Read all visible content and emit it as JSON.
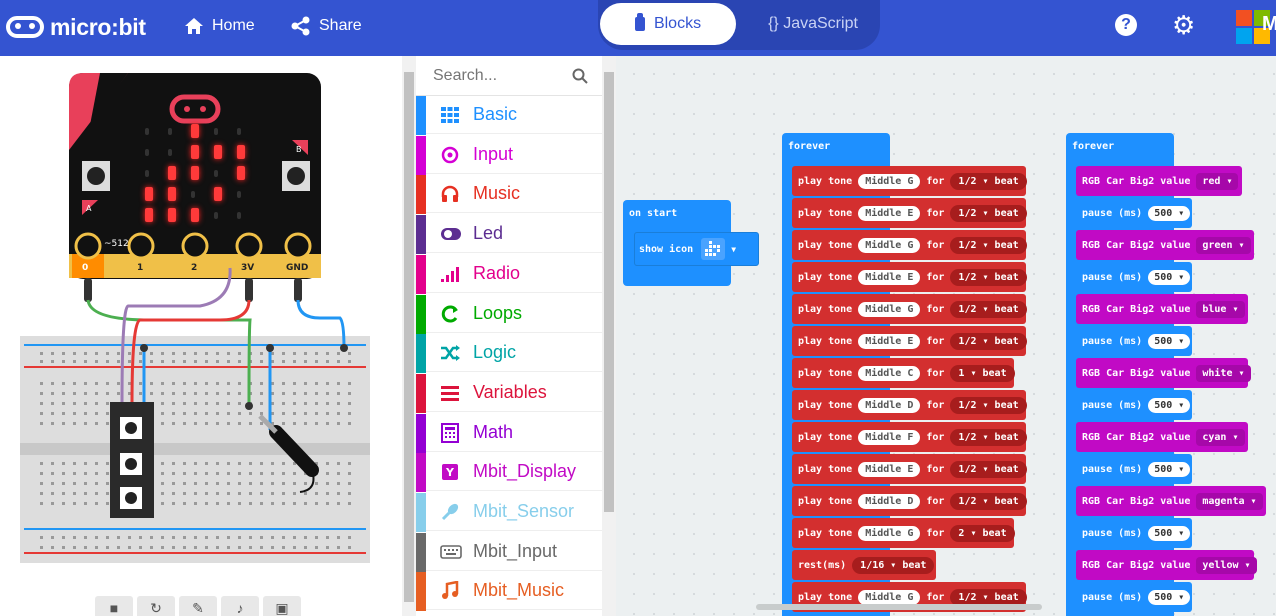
{
  "app": {
    "logo_text": "micro:bit"
  },
  "topbar": {
    "home_label": "Home",
    "share_label": "Share",
    "tabs": [
      {
        "label": "Blocks",
        "active": true
      },
      {
        "label": "{} JavaScript",
        "active": false
      }
    ],
    "ms_text": "M"
  },
  "simulator": {
    "pin_labels": [
      "0",
      "1",
      "2",
      "3V",
      "GND"
    ],
    "pin_indicator": "~512",
    "button_labels": [
      "A",
      "B"
    ],
    "led_matrix": [
      [
        0,
        0,
        1,
        0,
        0
      ],
      [
        0,
        0,
        1,
        1,
        1
      ],
      [
        0,
        1,
        1,
        0,
        1
      ],
      [
        1,
        1,
        0,
        1,
        0
      ],
      [
        1,
        1,
        1,
        0,
        0
      ]
    ]
  },
  "toolbox": {
    "search_placeholder": "Search...",
    "categories": [
      {
        "label": "Basic",
        "color": "#1e90ff",
        "icon": "grid-icon"
      },
      {
        "label": "Input",
        "color": "#d400d4",
        "icon": "target-icon"
      },
      {
        "label": "Music",
        "color": "#e63022",
        "icon": "headphones-icon"
      },
      {
        "label": "Led",
        "color": "#5c2d91",
        "icon": "toggle-icon"
      },
      {
        "label": "Radio",
        "color": "#e3008c",
        "icon": "signal-icon"
      },
      {
        "label": "Loops",
        "color": "#00aa00",
        "icon": "loop-icon"
      },
      {
        "label": "Logic",
        "color": "#00a4a6",
        "icon": "shuffle-icon"
      },
      {
        "label": "Variables",
        "color": "#dc143c",
        "icon": "lines-icon"
      },
      {
        "label": "Math",
        "color": "#9400d3",
        "icon": "calculator-icon"
      },
      {
        "label": "Mbit_Display",
        "color": "#c10ac5",
        "icon": "display-icon"
      },
      {
        "label": "Mbit_Sensor",
        "color": "#87ceeb",
        "icon": "sensor-icon"
      },
      {
        "label": "Mbit_Input",
        "color": "#696969",
        "icon": "keyboard-icon"
      },
      {
        "label": "Mbit_Music",
        "color": "#e65e22",
        "icon": "note-icon"
      }
    ]
  },
  "workspace": {
    "on_start": {
      "label": "on start",
      "show_icon": "show icon"
    },
    "forever1": {
      "label": "forever",
      "tones": [
        {
          "note": "Middle G",
          "beat": "1/2"
        },
        {
          "note": "Middle E",
          "beat": "1/2"
        },
        {
          "note": "Middle G",
          "beat": "1/2"
        },
        {
          "note": "Middle E",
          "beat": "1/2"
        },
        {
          "note": "Middle G",
          "beat": "1/2"
        },
        {
          "note": "Middle E",
          "beat": "1/2"
        },
        {
          "note": "Middle C",
          "beat": "1"
        },
        {
          "note": "Middle D",
          "beat": "1/2"
        },
        {
          "note": "Middle F",
          "beat": "1/2"
        },
        {
          "note": "Middle E",
          "beat": "1/2"
        },
        {
          "note": "Middle D",
          "beat": "1/2"
        },
        {
          "note": "Middle G",
          "beat": "2"
        }
      ],
      "rest": {
        "label": "rest(ms)",
        "beat": "1/16"
      },
      "last_tone": {
        "note": "Middle G",
        "beat": "1/2"
      },
      "play_tone": "play tone",
      "for_label": "for",
      "beat_label": "beat"
    },
    "forever2": {
      "label": "forever",
      "rgb_label": "RGB Car Big2 value",
      "pause_label": "pause (ms)",
      "colors": [
        "red",
        "green",
        "blue",
        "white",
        "cyan",
        "magenta",
        "yellow"
      ],
      "pause_value": "500"
    }
  }
}
